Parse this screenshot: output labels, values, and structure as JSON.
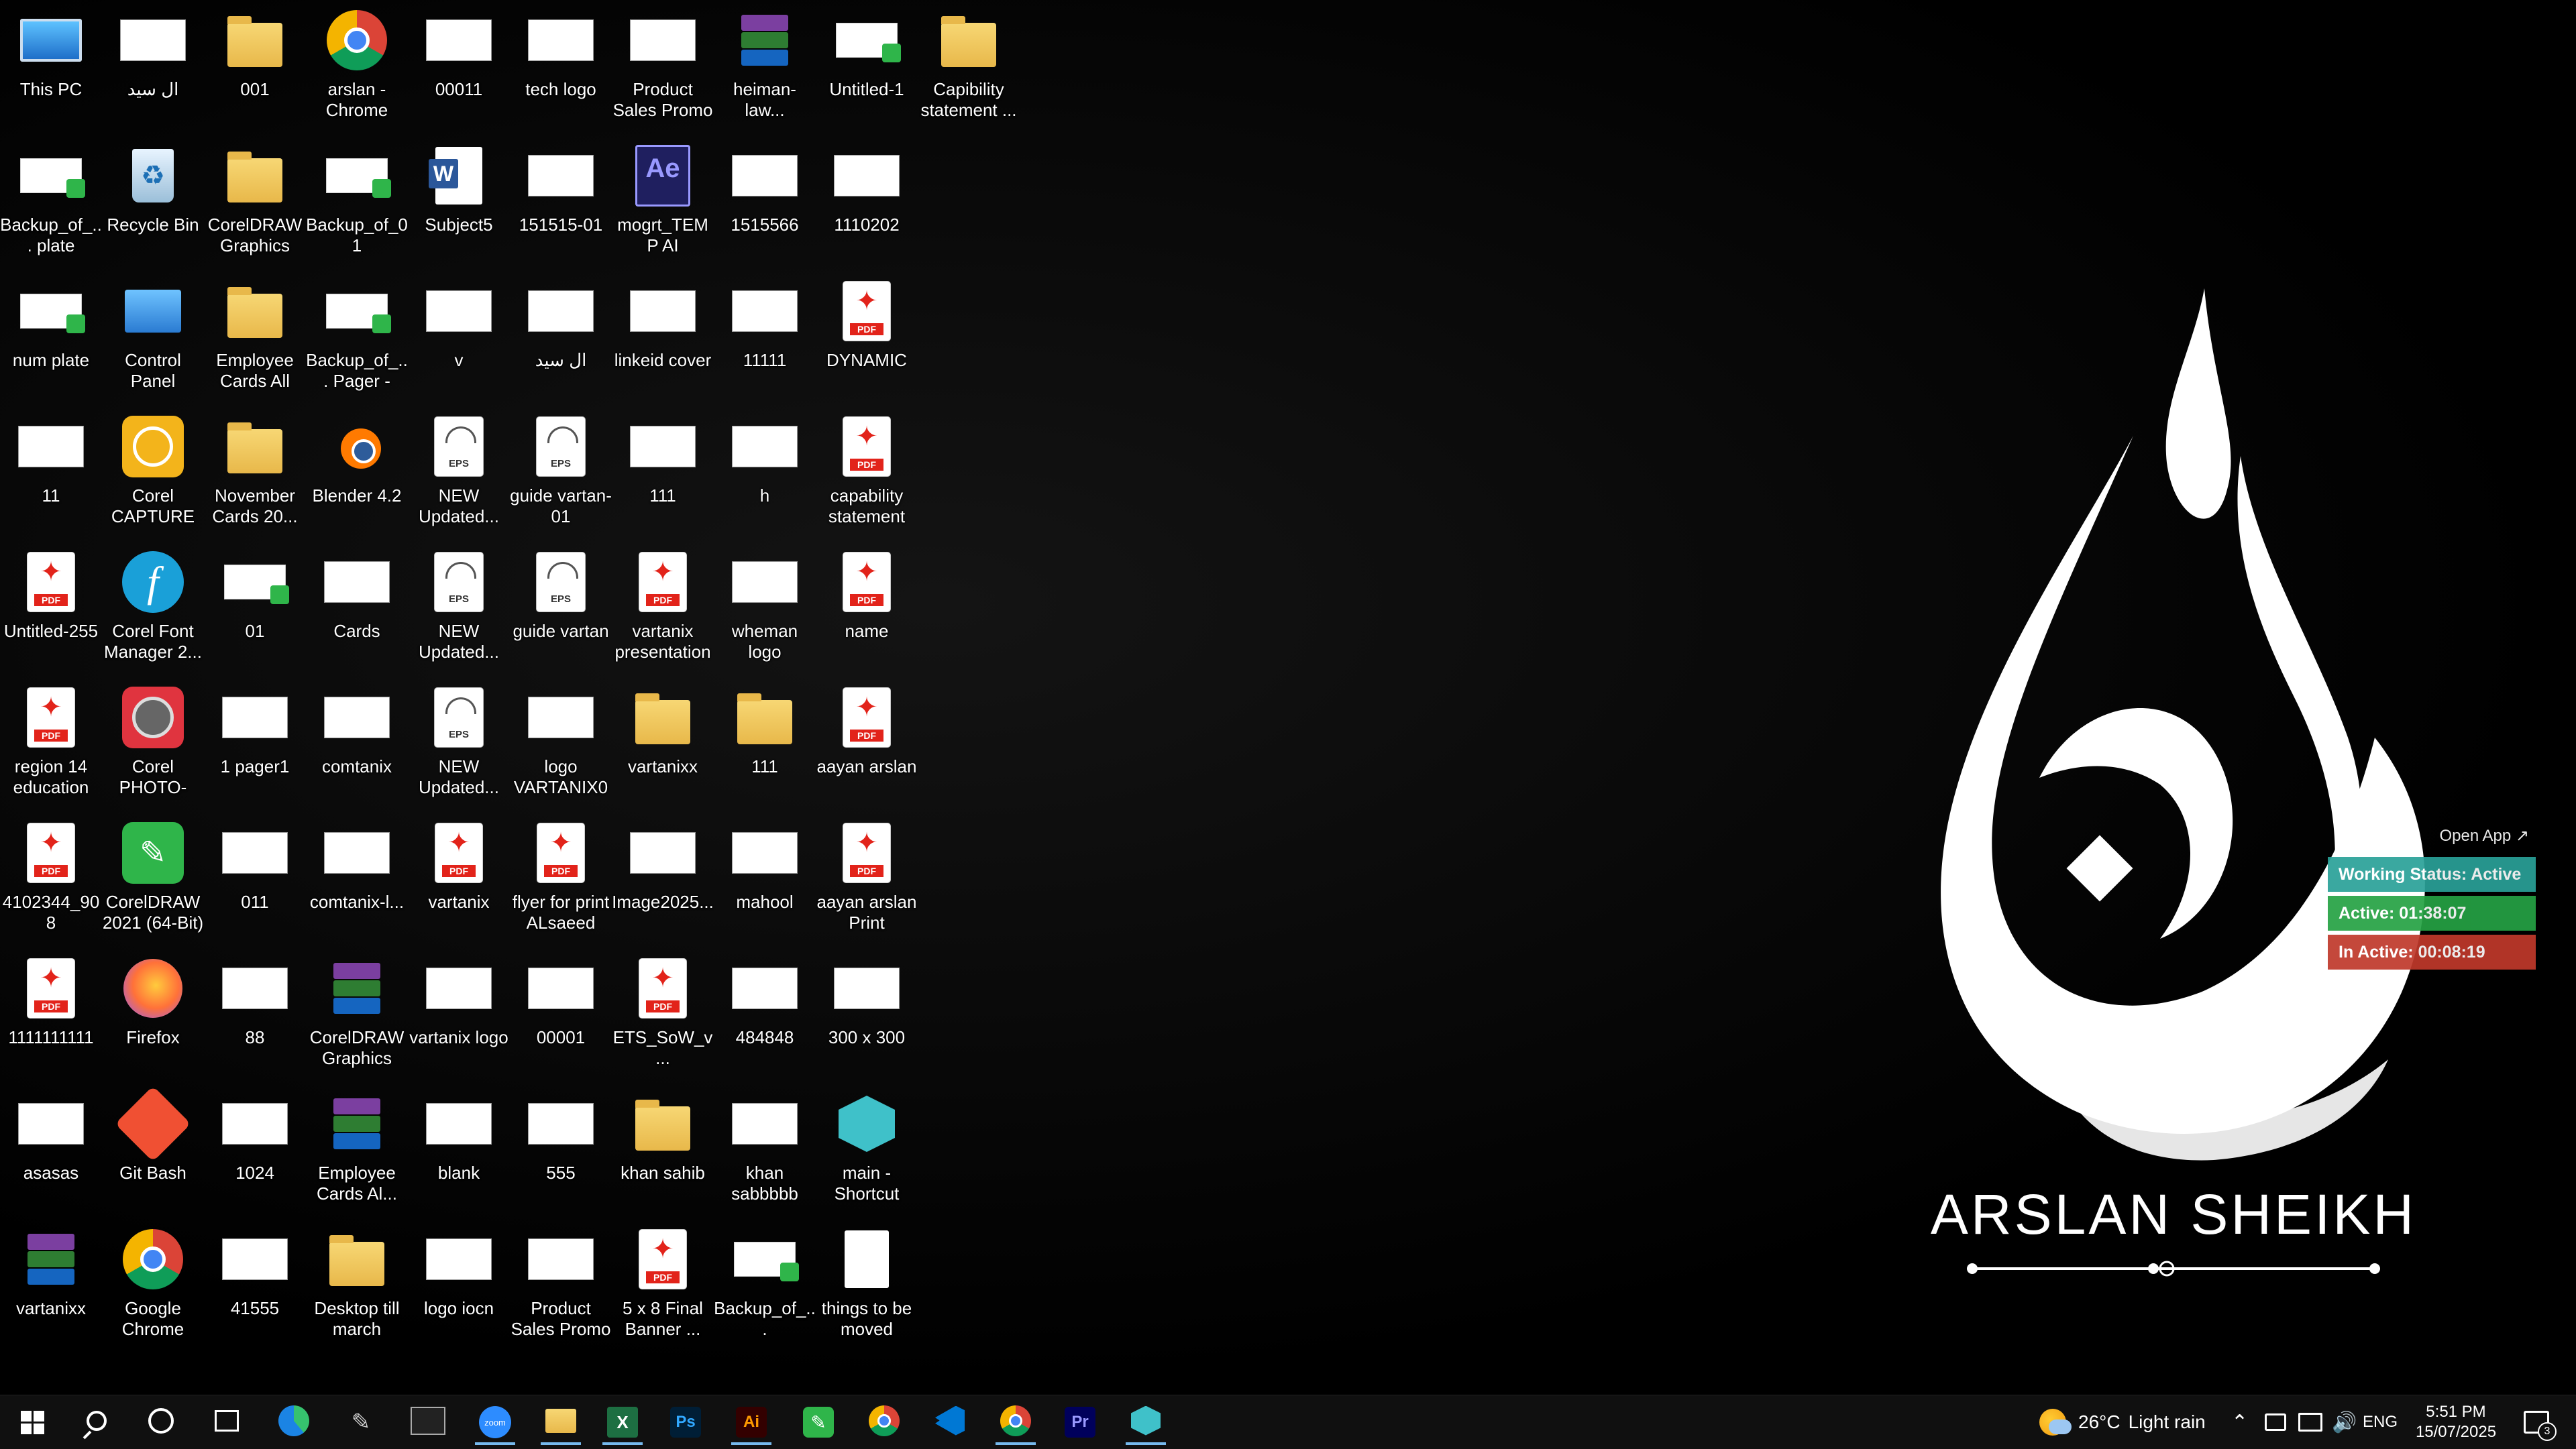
{
  "desktop": {
    "icons": [
      {
        "label": "This PC",
        "icon": "this-pc-icon"
      },
      {
        "label": "ال سيد",
        "icon": "image-file-icon"
      },
      {
        "label": "001",
        "icon": "folder-icon"
      },
      {
        "label": "arslan - Chrome",
        "icon": "chrome-profile-icon"
      },
      {
        "label": "00011",
        "icon": "image-file-icon"
      },
      {
        "label": "tech logo",
        "icon": "image-file-icon"
      },
      {
        "label": "Product Sales Promo Pack...",
        "icon": "image-file-icon"
      },
      {
        "label": "heiman-law...",
        "icon": "winrar-archive-icon"
      },
      {
        "label": "Untitled-1",
        "icon": "coreldraw-file-icon"
      },
      {
        "label": "Capibility statement ...",
        "icon": "folder-icon"
      },
      {
        "label": "Backup_of_... plate",
        "icon": "coreldraw-file-icon"
      },
      {
        "label": "Recycle Bin",
        "icon": "recycle-bin-icon"
      },
      {
        "label": "CorelDRAW Graphics Su...",
        "icon": "folder-icon"
      },
      {
        "label": "Backup_of_01",
        "icon": "coreldraw-file-icon"
      },
      {
        "label": "Subject5",
        "icon": "word-document-icon"
      },
      {
        "label": "151515-01",
        "icon": "image-file-icon"
      },
      {
        "label": "mogrt_TEMP AI (convert...",
        "icon": "after-effects-file-icon"
      },
      {
        "label": "1515566",
        "icon": "image-file-icon"
      },
      {
        "label": "1110202",
        "icon": "image-file-icon"
      },
      {
        "label": "num plate",
        "icon": "coreldraw-file-icon"
      },
      {
        "label": "Control Panel",
        "icon": "control-panel-icon"
      },
      {
        "label": "Employee Cards All",
        "icon": "folder-icon"
      },
      {
        "label": "Backup_of_... Pager - NY...",
        "icon": "coreldraw-file-icon"
      },
      {
        "label": "v",
        "icon": "image-file-icon"
      },
      {
        "label": "ال سيد",
        "icon": "image-file-icon"
      },
      {
        "label": "linkeid cover",
        "icon": "image-file-icon"
      },
      {
        "label": "11111",
        "icon": "image-file-icon"
      },
      {
        "label": "DYNAMIC",
        "icon": "pdf-file-icon"
      },
      {
        "label": "11",
        "icon": "image-file-icon"
      },
      {
        "label": "Corel CAPTURE 2...",
        "icon": "corel-capture-icon"
      },
      {
        "label": "November Cards 20...",
        "icon": "folder-icon"
      },
      {
        "label": "Blender 4.2",
        "icon": "blender-icon"
      },
      {
        "label": "NEW Updated...",
        "icon": "eps-file-icon"
      },
      {
        "label": "guide vartan-01",
        "icon": "eps-file-icon"
      },
      {
        "label": "111",
        "icon": "image-file-icon"
      },
      {
        "label": "h",
        "icon": "image-file-icon"
      },
      {
        "label": "capability statement",
        "icon": "pdf-file-icon"
      },
      {
        "label": "Untitled-255",
        "icon": "pdf-file-icon"
      },
      {
        "label": "Corel Font Manager 2...",
        "icon": "corel-font-manager-icon"
      },
      {
        "label": "01",
        "icon": "coreldraw-file-icon"
      },
      {
        "label": "Cards",
        "icon": "image-file-icon"
      },
      {
        "label": "NEW Updated...",
        "icon": "eps-file-icon"
      },
      {
        "label": "guide vartan",
        "icon": "eps-file-icon"
      },
      {
        "label": "vartanix presentation",
        "icon": "pdf-file-icon"
      },
      {
        "label": "wheman logo",
        "icon": "image-file-icon"
      },
      {
        "label": "name",
        "icon": "pdf-file-icon"
      },
      {
        "label": "region 14 education s...",
        "icon": "pdf-file-icon"
      },
      {
        "label": "Corel PHOTO-PAI...",
        "icon": "corel-photo-paint-icon"
      },
      {
        "label": "1 pager1",
        "icon": "image-file-icon"
      },
      {
        "label": "comtanix",
        "icon": "image-file-icon"
      },
      {
        "label": "NEW Updated...",
        "icon": "eps-file-icon"
      },
      {
        "label": "logo VARTANIX01",
        "icon": "image-file-icon"
      },
      {
        "label": "vartanixx",
        "icon": "folder-icon"
      },
      {
        "label": "111",
        "icon": "folder-icon"
      },
      {
        "label": "aayan arslan",
        "icon": "pdf-file-icon"
      },
      {
        "label": "4102344_908",
        "icon": "pdf-file-icon"
      },
      {
        "label": "CorelDRAW 2021 (64-Bit)",
        "icon": "coreldraw-app-icon"
      },
      {
        "label": "011",
        "icon": "image-file-icon"
      },
      {
        "label": "comtanix-l...",
        "icon": "image-file-icon"
      },
      {
        "label": "vartanix",
        "icon": "pdf-file-icon"
      },
      {
        "label": "flyer for print ALsaeed po...",
        "icon": "pdf-file-icon"
      },
      {
        "label": "Image2025...",
        "icon": "image-file-icon"
      },
      {
        "label": "mahool",
        "icon": "image-file-icon"
      },
      {
        "label": "aayan arslan Print",
        "icon": "pdf-file-icon"
      },
      {
        "label": "1111111111",
        "icon": "pdf-file-icon"
      },
      {
        "label": "Firefox",
        "icon": "firefox-icon"
      },
      {
        "label": "88",
        "icon": "image-file-icon"
      },
      {
        "label": "CorelDRAW Graphics Su...",
        "icon": "winrar-archive-icon"
      },
      {
        "label": "vartanix logo",
        "icon": "image-file-icon"
      },
      {
        "label": "00001",
        "icon": "image-file-icon"
      },
      {
        "label": "ETS_SoW_v...",
        "icon": "pdf-file-icon"
      },
      {
        "label": "484848",
        "icon": "image-file-icon"
      },
      {
        "label": "300 x 300",
        "icon": "image-file-icon"
      },
      {
        "label": "asasas",
        "icon": "image-file-icon"
      },
      {
        "label": "Git Bash",
        "icon": "git-bash-icon"
      },
      {
        "label": "1024",
        "icon": "image-file-icon"
      },
      {
        "label": "Employee Cards Al...",
        "icon": "winrar-archive-icon"
      },
      {
        "label": "blank",
        "icon": "image-file-icon"
      },
      {
        "label": "555",
        "icon": "image-file-icon"
      },
      {
        "label": "khan sahib",
        "icon": "folder-icon"
      },
      {
        "label": "khan sabbbbb",
        "icon": "image-file-icon"
      },
      {
        "label": "main - Shortcut",
        "icon": "app-shortcut-icon"
      },
      {
        "label": "vartanixx",
        "icon": "winrar-archive-icon"
      },
      {
        "label": "Google Chrome",
        "icon": "chrome-icon"
      },
      {
        "label": "41555",
        "icon": "image-file-icon"
      },
      {
        "label": "Desktop till march",
        "icon": "folder-icon"
      },
      {
        "label": "logo iocn",
        "icon": "image-file-icon"
      },
      {
        "label": "Product Sales Promo Pack...",
        "icon": "image-file-icon"
      },
      {
        "label": "5 x 8 Final Banner ...",
        "icon": "pdf-file-icon"
      },
      {
        "label": "Backup_of_...",
        "icon": "coreldraw-file-icon"
      },
      {
        "label": "things to be moved",
        "icon": "text-file-icon"
      }
    ]
  },
  "wallpaper": {
    "signature_text": "ARSLAN SHEIKH"
  },
  "widget": {
    "open_app": "Open App ↗",
    "working_status": "Working Status: Active",
    "active": "Active: 01:38:07",
    "inactive": "In Active: 00:08:19",
    "colors": {
      "working": "#2aa198",
      "active": "#25a244",
      "inactive": "#c0392b"
    }
  },
  "taskbar": {
    "apps": [
      {
        "name": "start-button",
        "icon": "windows-logo-icon"
      },
      {
        "name": "search-button",
        "icon": "search-icon"
      },
      {
        "name": "cortana-button",
        "icon": "cortana-circle-icon"
      },
      {
        "name": "task-view-button",
        "icon": "task-view-icon"
      },
      {
        "name": "edge-app",
        "icon": "edge-icon"
      },
      {
        "name": "pen-app",
        "icon": "pen-icon"
      },
      {
        "name": "terminal-app",
        "icon": "terminal-icon"
      },
      {
        "name": "zoom-app",
        "icon": "zoom-icon",
        "label": "zoom"
      },
      {
        "name": "file-explorer-app",
        "icon": "folder-icon"
      },
      {
        "name": "excel-app",
        "icon": "excel-icon",
        "label": "X"
      },
      {
        "name": "photoshop-app",
        "icon": "photoshop-icon",
        "label": "Ps"
      },
      {
        "name": "illustrator-app",
        "icon": "illustrator-icon",
        "label": "Ai"
      },
      {
        "name": "coreldraw-app",
        "icon": "coreldraw-icon"
      },
      {
        "name": "chrome-app",
        "icon": "chrome-icon"
      },
      {
        "name": "vscode-app",
        "icon": "vscode-icon"
      },
      {
        "name": "chrome-profile-app",
        "icon": "chrome-icon"
      },
      {
        "name": "premiere-app",
        "icon": "premiere-icon",
        "label": "Pr"
      },
      {
        "name": "tracker-app",
        "icon": "tracker-icon"
      }
    ],
    "weather": {
      "temp": "26°C",
      "condition": "Light rain"
    },
    "language": "ENG",
    "time": "5:51 PM",
    "date": "15/07/2025",
    "notifications": "3"
  }
}
